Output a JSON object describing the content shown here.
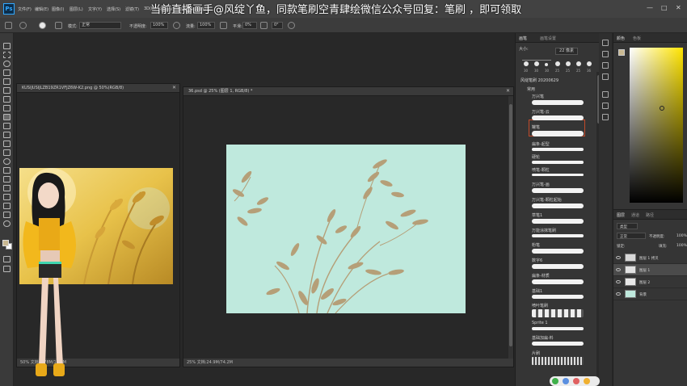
{
  "app": {
    "logo": "Ps"
  },
  "overlay_title": "当前直播画手@风绽丫鱼，同款笔刷空青肆绘微信公众号回复：笔刷 ，即可领取",
  "menu": [
    "文件(F)",
    "编辑(E)",
    "图像(I)",
    "图层(L)",
    "文字(Y)",
    "选择(S)",
    "滤镜(T)",
    "3D(D)",
    "视图(V)",
    "窗口(W)",
    "帮助(H)"
  ],
  "window_controls": {
    "minimize": "—",
    "maximize": "□",
    "close": "✕"
  },
  "options": {
    "mode_label": "模式:",
    "mode_value": "正常",
    "opacity_label": "不透明度:",
    "opacity_value": "100%",
    "flow_label": "流量:",
    "flow_value": "100%",
    "smooth_label": "平滑:",
    "smooth_value": "0%",
    "angle_value": "0°"
  },
  "doc_left": {
    "tab": "KUSIJUSIJLZB19ZR1VFJZ6W-K2.png @ 50%(RGB/8)",
    "status": "50%    文档:1.78M/1.79M"
  },
  "doc_main": {
    "tab": "36.psd @ 25% (图层 1, RGB/8) *",
    "status": "25%    文档:24.9M/74.2M"
  },
  "brushes_panel": {
    "tabs": [
      "画笔",
      "画笔设置"
    ],
    "size_label": "大小:",
    "size_value": "22 像素",
    "preset_sizes": [
      "30",
      "30",
      "30",
      "25",
      "25",
      "25",
      "36",
      "25"
    ],
    "folder_label": "风绽笔刷 20200629",
    "subfolder_label": "常用",
    "brushes": [
      {
        "name": "万兴笔"
      },
      {
        "name": "万兴笔-云"
      },
      {
        "name": "罐笔"
      },
      {
        "name": "扁条-起型"
      },
      {
        "name": "硬轮"
      },
      {
        "name": "喷笔-颗粒"
      },
      {
        "name": "万兴笔-画"
      },
      {
        "name": "万兴笔-颗粒起始"
      },
      {
        "name": "草笔1"
      },
      {
        "name": "万能涂抹笔刷"
      },
      {
        "name": "粉笔"
      },
      {
        "name": "数字6"
      },
      {
        "name": "扁条-材质"
      },
      {
        "name": "基础1"
      },
      {
        "name": "喷叶笔刷"
      },
      {
        "name": "Sprite 1"
      },
      {
        "name": "基础加扁-料"
      },
      {
        "name": "片刷"
      }
    ]
  },
  "color_panel": {
    "tabs": [
      "颜色",
      "色板"
    ]
  },
  "layers_panel": {
    "tabs": [
      "图层",
      "通道",
      "路径"
    ],
    "kind_label": "类型",
    "blend_value": "正常",
    "opacity_label": "不透明度:",
    "opacity_value": "100%",
    "lock_label": "锁定:",
    "fill_label": "填充:",
    "fill_value": "100%",
    "layers": [
      {
        "name": "图层 1 拷贝"
      },
      {
        "name": "图层 1"
      },
      {
        "name": "图层 2"
      },
      {
        "name": "背景"
      }
    ]
  },
  "colors": {
    "artwork_bg": "#bfe9dd",
    "plant": "#b59f78",
    "accent_selection": "#c24a2a",
    "foreground_swatch": "#c9b891"
  }
}
